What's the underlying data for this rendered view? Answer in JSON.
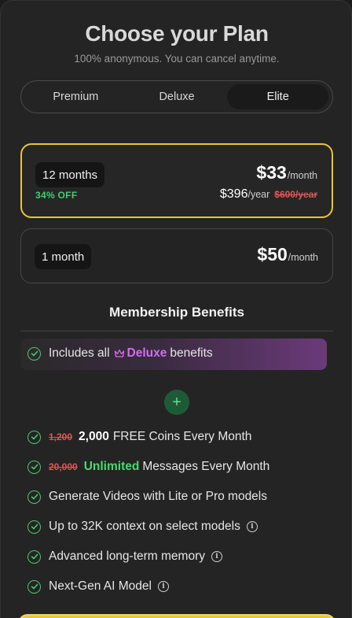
{
  "header": {
    "title": "Choose your Plan",
    "subtitle": "100% anonymous. You can cancel anytime."
  },
  "tabs": [
    {
      "label": "Premium",
      "active": false
    },
    {
      "label": "Deluxe",
      "active": false
    },
    {
      "label": "Elite",
      "active": true
    }
  ],
  "plans": {
    "yearly": {
      "duration": "12 months",
      "discount": "34% OFF",
      "price": "$33",
      "per": "/month",
      "yearly_price": "$396",
      "yearly_unit": "/year",
      "original_yearly": "$600/year",
      "selected": true
    },
    "monthly": {
      "duration": "1 month",
      "price": "$50",
      "per": "/month",
      "selected": false
    }
  },
  "benefits": {
    "title": "Membership Benefits",
    "includes": {
      "prefix": "Includes all",
      "tier": "Deluxe",
      "suffix": "benefits",
      "icon": "crown-icon"
    },
    "coins": {
      "old": "1,200",
      "new": "2,000",
      "text": "FREE Coins Every Month"
    },
    "messages": {
      "old": "20,000",
      "highlight": "Unlimited",
      "text": "Messages Every Month"
    },
    "videos": {
      "text": "Generate Videos with Lite or Pro models"
    },
    "context": {
      "text": "Up to 32K context on select models"
    },
    "memory": {
      "text": "Advanced long-term memory"
    },
    "model": {
      "text": "Next-Gen AI Model"
    }
  },
  "colors": {
    "accent_gold": "#e9c33c",
    "discount_green": "#3fcf6d",
    "strike_red": "#e05656",
    "deluxe_purple": "#d46bf0"
  }
}
